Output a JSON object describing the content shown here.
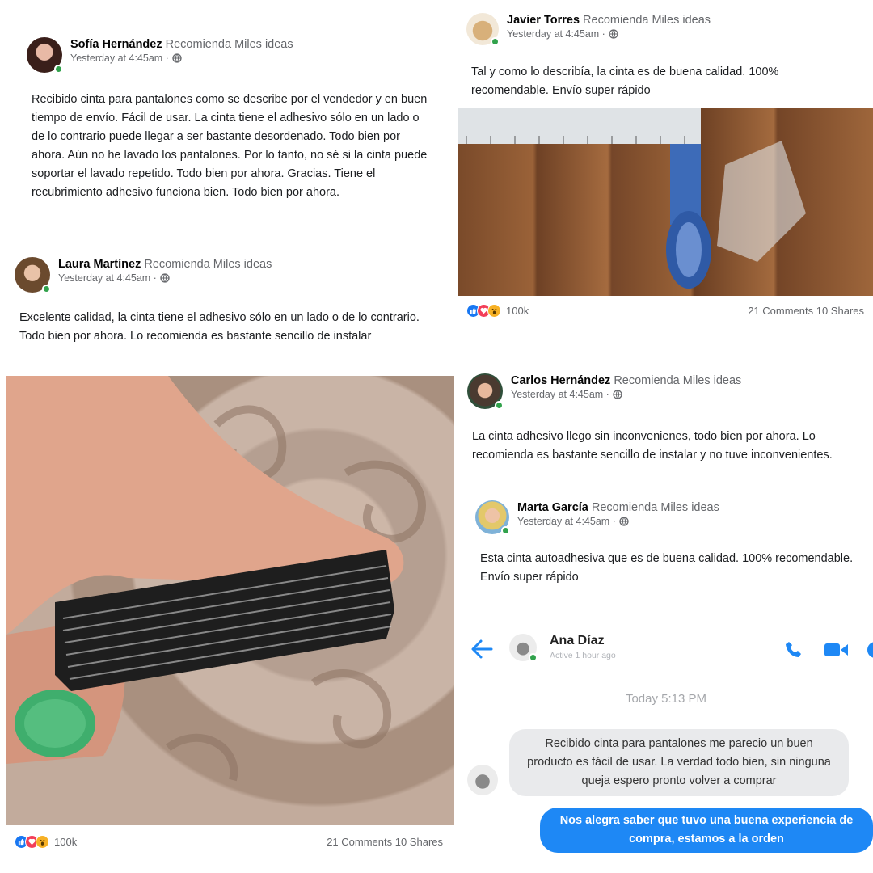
{
  "posts": [
    {
      "name": "Sofía Hernández",
      "recommends": "Recomienda Miles ideas",
      "time": "Yesterday at 4:45am ·",
      "text": "Recibido cinta para pantalones como se describe por el vendedor y en buen tiempo de envío. Fácil de usar. La cinta tiene el adhesivo sólo en un lado o de lo contrario puede llegar a ser bastante desordenado. Todo bien por ahora. Aún no he lavado los pantalones. Por lo tanto, no sé si la cinta puede soportar el lavado repetido. Todo bien por ahora. Gracias. Tiene el recubrimiento adhesivo funciona bien. Todo bien por ahora."
    },
    {
      "name": "Javier Torres",
      "recommends": "Recomienda Miles ideas",
      "time": "Yesterday at 4:45am ·",
      "text": "Tal y como lo describía, la cinta es de buena calidad. 100% recomendable. Envío super rápido",
      "reactions_count": "100k",
      "comments_shares": "21 Comments 10 Shares"
    },
    {
      "name": "Laura Martínez",
      "recommends": "Recomienda Miles ideas",
      "time": "Yesterday at 4:45am ·",
      "text": "Excelente calidad, la cinta tiene el adhesivo sólo en un lado o de lo contrario. Todo bien por ahora. Lo recomienda es bastante sencillo de instalar",
      "reactions_count": "100k",
      "comments_shares": "21 Comments 10 Shares"
    },
    {
      "name": "Carlos Hernández",
      "recommends": "Recomienda Miles ideas",
      "time": "Yesterday at 4:45am ·",
      "text": "La cinta adhesivo llego sin inconvenienes, todo bien por ahora. Lo recomienda es bastante sencillo de instalar y no tuve inconvenientes."
    },
    {
      "name": "Marta García",
      "recommends": "Recomienda Miles ideas",
      "time": "Yesterday at 4:45am ·",
      "text": "Esta cinta autoadhesiva que es de buena calidad. 100% recomendable. Envío super rápido"
    }
  ],
  "messenger": {
    "contact_name": "Ana Díaz",
    "status": "Active 1 hour ago",
    "timestamp": "Today 5:13 PM",
    "incoming": "Recibido cinta para pantalones me parecio un buen producto es fácil de usar. La verdad todo bien, sin ninguna queja espero pronto volver a comprar",
    "outgoing": "Nos alegra saber que tuvo una buena experiencia de compra, estamos a la orden"
  },
  "colors": {
    "messenger_blue": "#1e88f5",
    "online_green": "#31a24c",
    "like_blue": "#1877f2",
    "love_red": "#f33e58",
    "wow_yellow": "#f7b125"
  },
  "icons": [
    "globe-icon",
    "like-reaction-icon",
    "love-reaction-icon",
    "wow-reaction-icon",
    "back-arrow-icon",
    "phone-icon",
    "video-call-icon",
    "info-icon"
  ]
}
